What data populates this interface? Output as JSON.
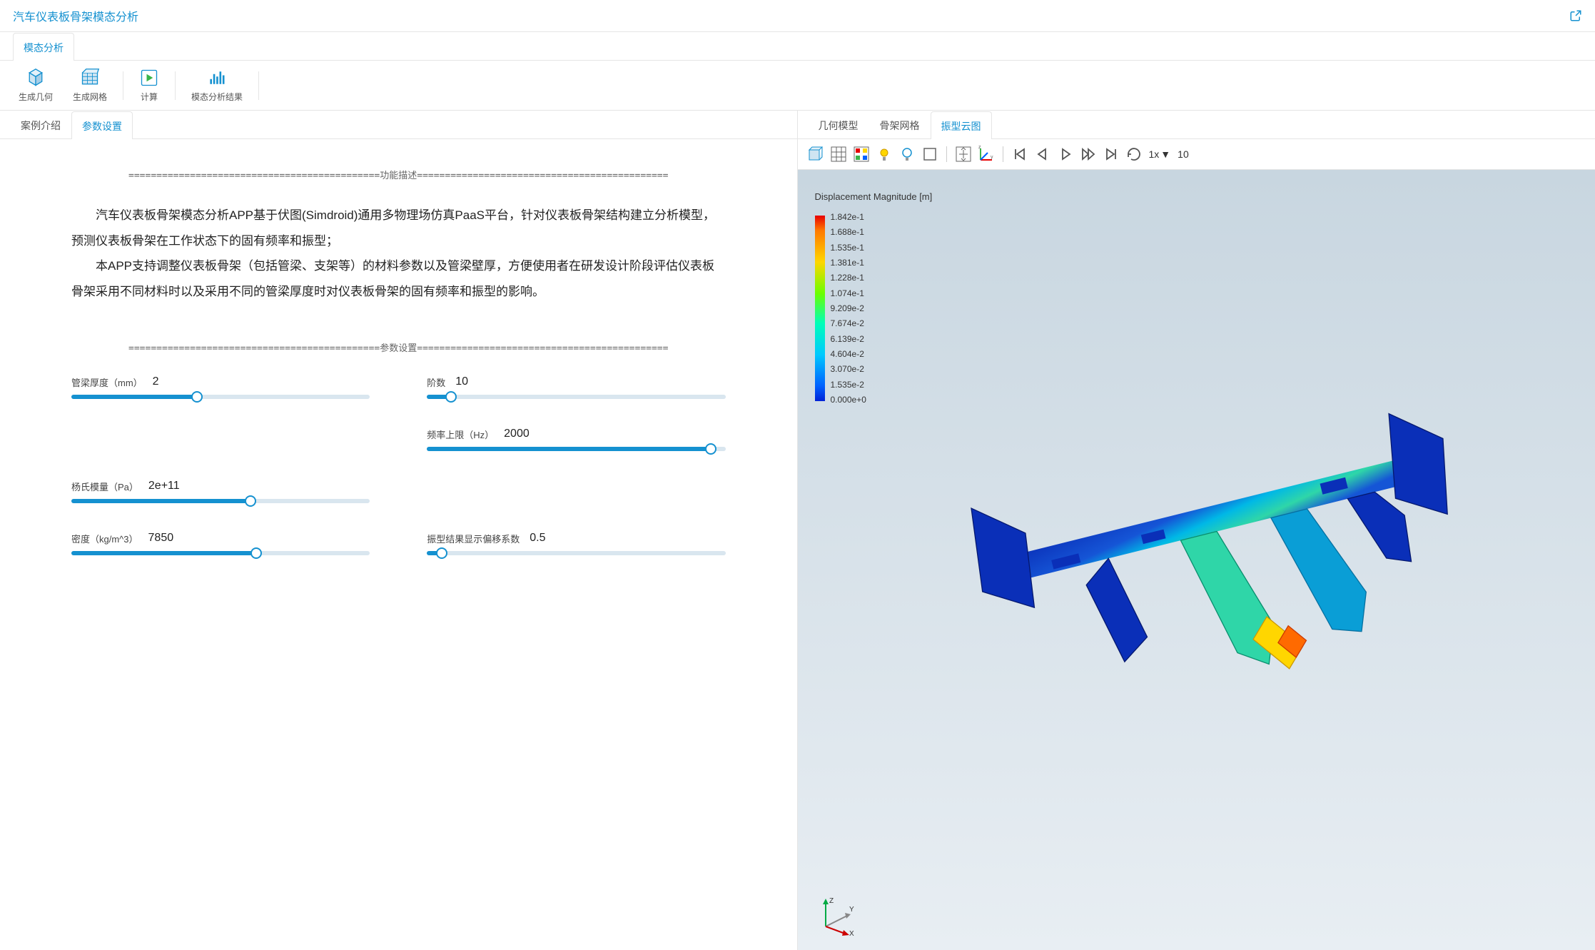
{
  "header": {
    "title": "汽车仪表板骨架模态分析",
    "popout_label": "open-new-window"
  },
  "main_tab": {
    "label": "模态分析"
  },
  "toolbar": [
    {
      "name": "generate-geometry",
      "label": "生成几何"
    },
    {
      "name": "generate-mesh",
      "label": "生成网格"
    },
    {
      "name": "compute",
      "label": "计算"
    },
    {
      "name": "modal-results",
      "label": "模态分析结果"
    }
  ],
  "left_tabs": [
    {
      "name": "case-intro",
      "label": "案例介绍",
      "active": false
    },
    {
      "name": "param-settings",
      "label": "参数设置",
      "active": true
    }
  ],
  "sections": {
    "desc_title": "功能描述",
    "params_title": "参数设置"
  },
  "description": {
    "p1": "汽车仪表板骨架模态分析APP基于伏图(Simdroid)通用多物理场仿真PaaS平台，针对仪表板骨架结构建立分析模型，预测仪表板骨架在工作状态下的固有频率和振型；",
    "p2": "本APP支持调整仪表板骨架（包括管梁、支架等）的材料参数以及管梁壁厚，方便使用者在研发设计阶段评估仪表板骨架采用不同材料时以及采用不同的管梁厚度时对仪表板骨架的固有频率和振型的影响。"
  },
  "params": {
    "thickness": {
      "label": "管梁厚度（mm）",
      "value": "2",
      "pct": 42
    },
    "orders": {
      "label": "阶数",
      "value": "10",
      "pct": 8
    },
    "youngs": {
      "label": "杨氏模量（Pa）",
      "value": "2e+11",
      "pct": 60
    },
    "freq_upper": {
      "label": "频率上限（Hz）",
      "value": "2000",
      "pct": 95
    },
    "density": {
      "label": "密度（kg/m^3）",
      "value": "7850",
      "pct": 62
    },
    "disp_coef": {
      "label": "振型结果显示偏移系数",
      "value": "0.5",
      "pct": 5
    }
  },
  "right_tabs": [
    {
      "name": "geo-model",
      "label": "几何模型",
      "active": false
    },
    {
      "name": "skeleton-mesh",
      "label": "骨架网格",
      "active": false
    },
    {
      "name": "mode-shape",
      "label": "振型云图",
      "active": true
    }
  ],
  "playback": {
    "speed": "1x",
    "frame": "10"
  },
  "legend": {
    "title": "Displacement Magnitude [m]",
    "values": [
      "1.842e-1",
      "1.688e-1",
      "1.535e-1",
      "1.381e-1",
      "1.228e-1",
      "1.074e-1",
      "9.209e-2",
      "7.674e-2",
      "6.139e-2",
      "4.604e-2",
      "3.070e-2",
      "1.535e-2",
      "0.000e+0"
    ]
  },
  "axis": {
    "x": "X",
    "y": "Y",
    "z": "Z"
  }
}
